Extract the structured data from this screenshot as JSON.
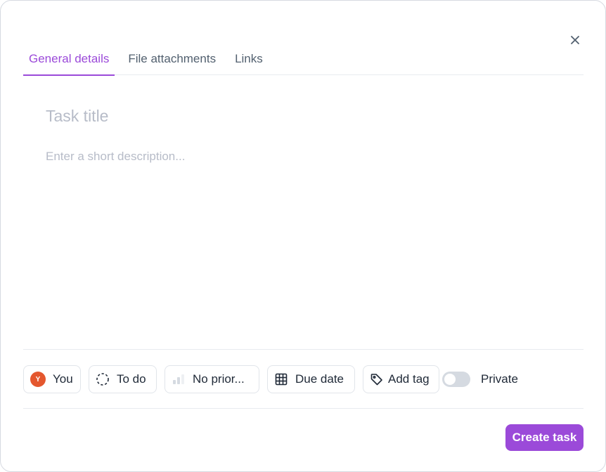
{
  "tabs": [
    {
      "label": "General details",
      "active": true
    },
    {
      "label": "File attachments",
      "active": false
    },
    {
      "label": "Links",
      "active": false
    }
  ],
  "form": {
    "title_placeholder": "Task title",
    "description_placeholder": "Enter a short description..."
  },
  "attributes": {
    "assignee": {
      "initial": "Y",
      "label": "You",
      "avatar_color": "#e4572e"
    },
    "status": {
      "label": "To do",
      "icon": "dashed-circle-icon"
    },
    "priority": {
      "label": "No prior...",
      "icon": "priority-bars-icon"
    },
    "due_date": {
      "label": "Due date",
      "icon": "calendar-grid-icon"
    },
    "tag": {
      "label": "Add tag",
      "icon": "tag-icon"
    },
    "private": {
      "label": "Private",
      "enabled": false
    }
  },
  "footer": {
    "create_label": "Create task"
  },
  "colors": {
    "accent": "#9b4ad9",
    "text": "#1f2937",
    "muted": "#b7bcc8"
  }
}
